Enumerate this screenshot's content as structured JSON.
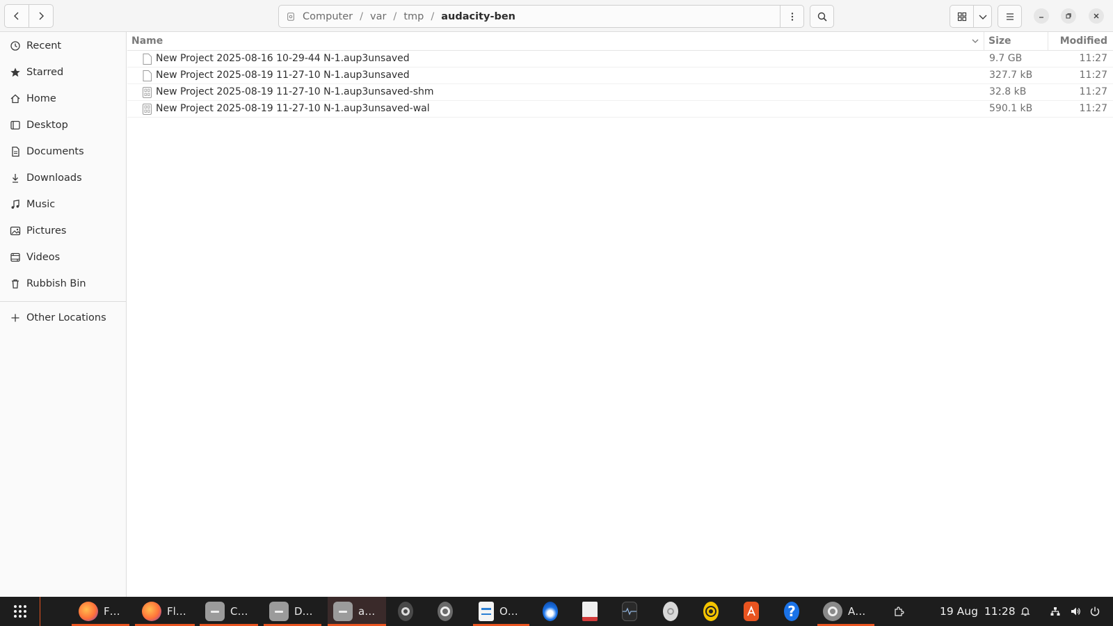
{
  "pathbar": {
    "crumbs": [
      "Computer",
      "var",
      "tmp"
    ],
    "current": "audacity-ben"
  },
  "sidebar": {
    "items": [
      {
        "label": "Recent",
        "icon": "clock-icon"
      },
      {
        "label": "Starred",
        "icon": "star-icon"
      },
      {
        "label": "Home",
        "icon": "home-icon"
      },
      {
        "label": "Desktop",
        "icon": "desktop-icon"
      },
      {
        "label": "Documents",
        "icon": "document-icon"
      },
      {
        "label": "Downloads",
        "icon": "download-icon"
      },
      {
        "label": "Music",
        "icon": "music-icon"
      },
      {
        "label": "Pictures",
        "icon": "picture-icon"
      },
      {
        "label": "Videos",
        "icon": "video-icon"
      },
      {
        "label": "Rubbish Bin",
        "icon": "trash-icon"
      }
    ],
    "other": "Other Locations"
  },
  "columns": {
    "name": "Name",
    "size": "Size",
    "modified": "Modified"
  },
  "files": [
    {
      "name": "New Project 2025-08-16 10-29-44 N-1.aup3unsaved",
      "size": "9.7 GB",
      "modified": "11:27",
      "icon": "text-file-icon"
    },
    {
      "name": "New Project 2025-08-19 11-27-10 N-1.aup3unsaved",
      "size": "327.7 kB",
      "modified": "11:27",
      "icon": "text-file-icon"
    },
    {
      "name": "New Project 2025-08-19 11-27-10 N-1.aup3unsaved-shm",
      "size": "32.8 kB",
      "modified": "11:27",
      "icon": "binary-file-icon"
    },
    {
      "name": "New Project 2025-08-19 11-27-10 N-1.aup3unsaved-wal",
      "size": "590.1 kB",
      "modified": "11:27",
      "icon": "binary-file-icon"
    }
  ],
  "taskbar": {
    "tasks": [
      {
        "label": "F…",
        "icon": "firefox-icon"
      },
      {
        "label": "Fl…",
        "icon": "firefox-icon"
      },
      {
        "label": "C…",
        "icon": "files-icon"
      },
      {
        "label": "D…",
        "icon": "files-icon"
      },
      {
        "label": "a…",
        "icon": "files-icon"
      },
      {
        "label": "O…",
        "icon": "writer-icon"
      },
      {
        "label": "A…",
        "icon": "settings-icon"
      }
    ],
    "date": "19 Aug",
    "time": "11:28"
  },
  "colors": {
    "accent": "#e95420",
    "taskbar": "#1d1d1d"
  }
}
